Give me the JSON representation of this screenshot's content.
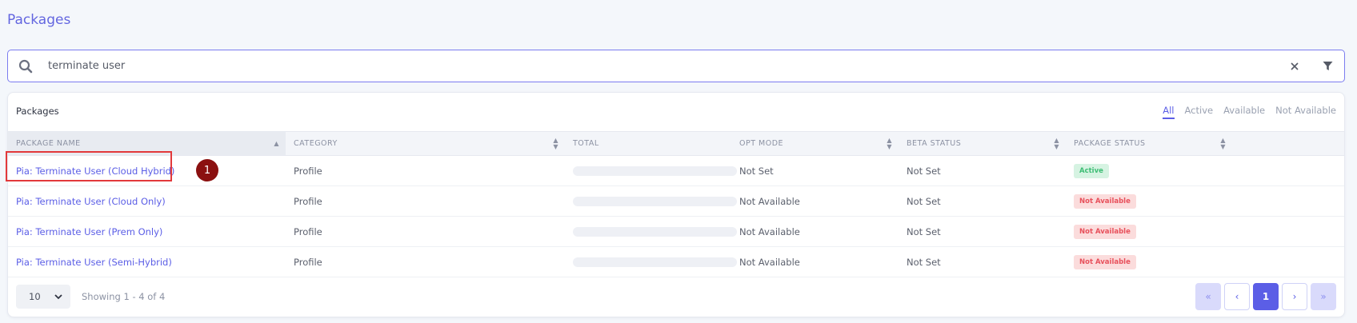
{
  "page": {
    "title": "Packages"
  },
  "search": {
    "value": "terminate user",
    "placeholder": ""
  },
  "card": {
    "title": "Packages",
    "tabs": [
      {
        "label": "All",
        "active": true
      },
      {
        "label": "Active",
        "active": false
      },
      {
        "label": "Available",
        "active": false
      },
      {
        "label": "Not Available",
        "active": false
      }
    ]
  },
  "table": {
    "columns": {
      "name": "PACKAGE NAME",
      "category": "CATEGORY",
      "total": "TOTAL",
      "opt_mode": "OPT MODE",
      "beta_status": "BETA STATUS",
      "package_status": "PACKAGE STATUS"
    },
    "rows": [
      {
        "name": "Pia: Terminate User (Cloud Hybrid)",
        "category": "Profile",
        "total_progress": 0,
        "opt_mode": "Not Set",
        "beta_status": "Not Set",
        "package_status": "Active",
        "status_kind": "active"
      },
      {
        "name": "Pia: Terminate User (Cloud Only)",
        "category": "Profile",
        "total_progress": 0,
        "opt_mode": "Not Available",
        "beta_status": "Not Set",
        "package_status": "Not Available",
        "status_kind": "not-available"
      },
      {
        "name": "Pia: Terminate User (Prem Only)",
        "category": "Profile",
        "total_progress": 0,
        "opt_mode": "Not Available",
        "beta_status": "Not Set",
        "package_status": "Not Available",
        "status_kind": "not-available"
      },
      {
        "name": "Pia: Terminate User (Semi-Hybrid)",
        "category": "Profile",
        "total_progress": 0,
        "opt_mode": "Not Available",
        "beta_status": "Not Set",
        "package_status": "Not Available",
        "status_kind": "not-available"
      }
    ]
  },
  "annotation": {
    "marker_label": "1"
  },
  "footer": {
    "per_page": "10",
    "showing": "Showing 1 - 4 of 4",
    "pager": {
      "first": "«",
      "prev": "‹",
      "current": "1",
      "next": "›",
      "last": "»"
    }
  },
  "colors": {
    "accent": "#5b5ee6",
    "active_badge_bg": "#d6f3e2",
    "active_badge_text": "#3dbd74",
    "not_available_badge_bg": "#fbdcdc",
    "not_available_badge_text": "#e8505b",
    "highlight": "#e2393b",
    "marker": "#8b1010"
  },
  "icons": {
    "search": "search-icon",
    "clear": "close-icon",
    "filter": "filter-icon",
    "sort": "sort-icon",
    "dropdown": "chevron-down-icon"
  }
}
